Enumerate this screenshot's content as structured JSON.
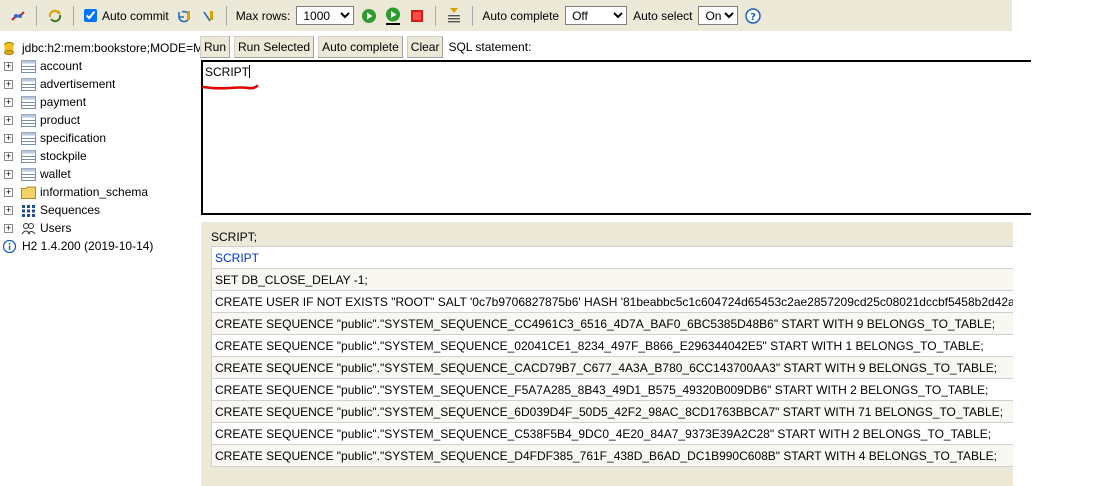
{
  "toolbar": {
    "auto_commit_label": "Auto commit",
    "auto_commit_checked": true,
    "max_rows_label": "Max rows:",
    "max_rows_value": "1000",
    "auto_complete_label": "Auto complete",
    "auto_complete_value": "Off",
    "auto_select_label": "Auto select",
    "auto_select_value": "On",
    "help_glyph": "?"
  },
  "connection": {
    "label": "jdbc:h2:mem:bookstore;MODE=M"
  },
  "tree": {
    "tables": [
      "account",
      "advertisement",
      "payment",
      "product",
      "specification",
      "stockpile",
      "wallet"
    ],
    "schema": "information_schema",
    "sequences": "Sequences",
    "users": "Users",
    "version": "H2 1.4.200 (2019-10-14)"
  },
  "commands": {
    "run": "Run",
    "run_selected": "Run Selected",
    "auto_complete": "Auto complete",
    "clear": "Clear",
    "sql_label": "SQL statement:"
  },
  "editor": {
    "text": "SCRIPT"
  },
  "results": {
    "query": "SCRIPT;",
    "column": "SCRIPT",
    "rows": [
      "SET DB_CLOSE_DELAY -1;",
      "CREATE USER IF NOT EXISTS \"ROOT\" SALT '0c7b9706827875b6' HASH '81beabbc5c1c604724d65453c2ae2857209cd25c08021dccbf5458b2d42a",
      "CREATE SEQUENCE \"public\".\"SYSTEM_SEQUENCE_CC4961C3_6516_4D7A_BAF0_6BC5385D48B6\" START WITH 9 BELONGS_TO_TABLE;",
      "CREATE SEQUENCE \"public\".\"SYSTEM_SEQUENCE_02041CE1_8234_497F_B866_E296344042E5\" START WITH 1 BELONGS_TO_TABLE;",
      "CREATE SEQUENCE \"public\".\"SYSTEM_SEQUENCE_CACD79B7_C677_4A3A_B780_6CC143700AA3\" START WITH 9 BELONGS_TO_TABLE;",
      "CREATE SEQUENCE \"public\".\"SYSTEM_SEQUENCE_F5A7A285_8B43_49D1_B575_49320B009DB6\" START WITH 2 BELONGS_TO_TABLE;",
      "CREATE SEQUENCE \"public\".\"SYSTEM_SEQUENCE_6D039D4F_50D5_42F2_98AC_8CD1763BBCA7\" START WITH 71 BELONGS_TO_TABLE;",
      "CREATE SEQUENCE \"public\".\"SYSTEM_SEQUENCE_C538F5B4_9DC0_4E20_84A7_9373E39A2C28\" START WITH 2 BELONGS_TO_TABLE;",
      "CREATE SEQUENCE \"public\".\"SYSTEM_SEQUENCE_D4FDF385_761F_438D_B6AD_DC1B990C608B\" START WITH 4 BELONGS_TO_TABLE;"
    ]
  },
  "colors": {
    "toolbar_bg": "#ece9d8",
    "header_link": "#0033cc",
    "annotation_red": "#e00000"
  },
  "icons": [
    "disconnect-icon",
    "refresh-icon",
    "rollback-icon",
    "commit-icon",
    "run-icon",
    "run-selected-icon",
    "stop-icon",
    "history-icon",
    "help-icon",
    "database-icon",
    "table-icon",
    "folder-icon",
    "sequences-icon",
    "users-icon",
    "info-icon"
  ]
}
